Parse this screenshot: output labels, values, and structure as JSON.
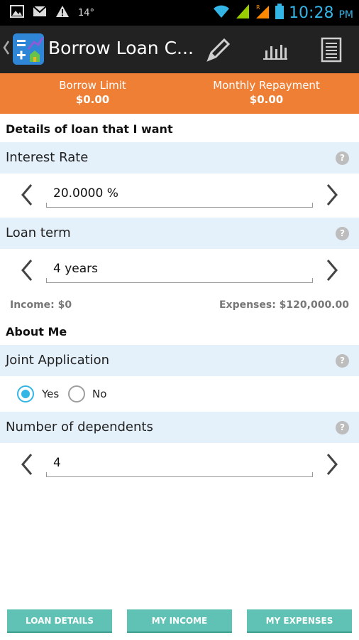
{
  "status_bar": {
    "temperature": "14°",
    "time": "10:28",
    "ampm": "PM",
    "accent_color": "#33b5e5"
  },
  "action_bar": {
    "title": "Borrow Loan C...",
    "icons": [
      "back-chevron-icon",
      "app-calculator-icon",
      "pencil-icon",
      "bar-chart-icon",
      "document-icon"
    ]
  },
  "summary": {
    "borrow_limit_label": "Borrow Limit",
    "borrow_limit_value": "$0.00",
    "monthly_repayment_label": "Monthly Repayment",
    "monthly_repayment_value": "$0.00",
    "color": "#f07f36"
  },
  "loan_section": {
    "title": "Details of loan that I want",
    "interest_rate_label": "Interest Rate",
    "interest_rate_value": "20.0000 %",
    "loan_term_label": "Loan term",
    "loan_term_value": "4 years",
    "help_glyph": "?"
  },
  "totals": {
    "income": "Income: $0",
    "expenses": "Expenses: $120,000.00"
  },
  "about_section": {
    "title": "About Me",
    "joint_label": "Joint Application",
    "joint_options": [
      "Yes",
      "No"
    ],
    "joint_selected": "Yes",
    "dependents_label": "Number of dependents",
    "dependents_value": "4"
  },
  "bottom_buttons": {
    "loan_details": "LOAN DETAILS",
    "my_income": "MY INCOME",
    "my_expenses": "MY EXPENSES",
    "color": "#5fc2b4"
  }
}
